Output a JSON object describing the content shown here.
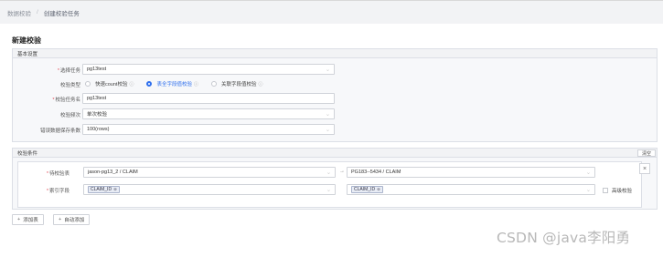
{
  "breadcrumb": {
    "parent": "数据校验",
    "separator": "/",
    "current": "创建校验任务"
  },
  "page_title": "新建校验",
  "basic": {
    "header": "基本设置",
    "task": {
      "label": "选择任务",
      "value": "pg13test",
      "required": true
    },
    "type": {
      "label": "校验类型",
      "options": [
        {
          "label": "快速count校验",
          "selected": false
        },
        {
          "label": "表全字段值校验",
          "selected": true
        },
        {
          "label": "关联字段值校验",
          "selected": false
        }
      ]
    },
    "name": {
      "label": "校验任务名",
      "value": "pg13test",
      "required": true
    },
    "frequency": {
      "label": "校验频次",
      "value": "单次校验"
    },
    "error_count": {
      "label": "错误数据保存条数",
      "value": "100(rows)"
    }
  },
  "conditions": {
    "header": "校验条件",
    "clear_label": "清空",
    "source_table": {
      "label": "待校验表",
      "value": "jason-pg13_2 / CLAIM",
      "required": true
    },
    "target_table": {
      "value": "PG183--5434 / CLAIM"
    },
    "index_field": {
      "label": "索引字段",
      "required": true,
      "source_tag": "CLAIM_ID",
      "target_tag": "CLAIM_ID"
    },
    "advanced_label": "高级校验"
  },
  "actions": {
    "add_table": "添加表",
    "auto_add": "自动添加"
  },
  "watermark": "CSDN @java李阳勇",
  "colors": {
    "accent": "#2f6fed",
    "required": "#e34d59"
  }
}
